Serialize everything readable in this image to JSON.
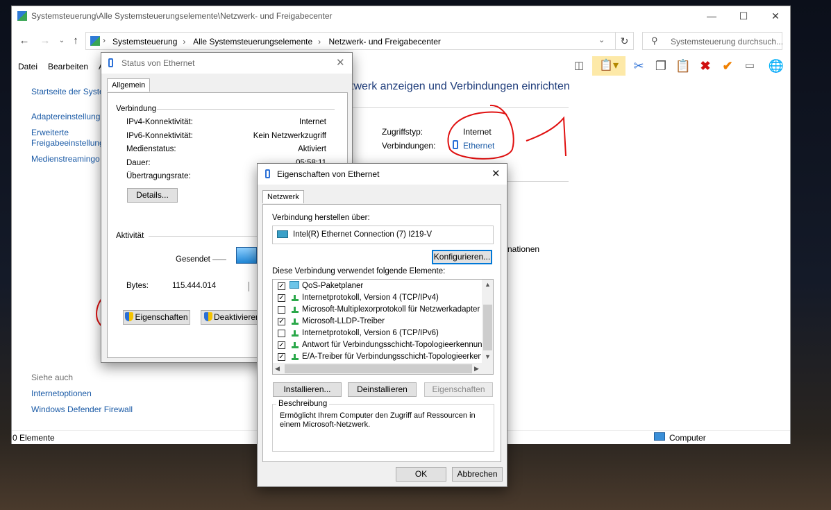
{
  "window": {
    "title": "Systemsteuerung\\Alle Systemsteuerungselemente\\Netzwerk- und Freigabecenter",
    "breadcrumbs": [
      "Systemsteuerung",
      "Alle Systemsteuerungselemente",
      "Netzwerk- und Freigabecenter"
    ],
    "search_placeholder": "Systemsteuerung durchsuch...",
    "menu": [
      "Datei",
      "Bearbeiten",
      "A"
    ],
    "heading": "twerk anzeigen und Verbindungen einrichten",
    "status_count": "0 Elemente",
    "status_location": "Computer"
  },
  "sidebar": {
    "items": [
      "Startseite der Syster",
      "Adaptereinstellung",
      "Erweiterte",
      "Freigabeeinstellung",
      "Medienstreamingo"
    ],
    "see_also_title": "Siehe auch",
    "see_also": [
      "Internetoptionen",
      "Windows Defender Firewall"
    ]
  },
  "network": {
    "access_label": "Zugriffstyp:",
    "access_value": "Internet",
    "connections_label": "Verbindungen:",
    "connections_value": "Ethernet",
    "partial_text": "nationen"
  },
  "status_dialog": {
    "title": "Status von Ethernet",
    "tab": "Allgemein",
    "group_connection": "Verbindung",
    "rows": [
      {
        "label": "IPv4-Konnektivität:",
        "value": "Internet"
      },
      {
        "label": "IPv6-Konnektivität:",
        "value": "Kein Netzwerkzugriff"
      },
      {
        "label": "Medienstatus:",
        "value": "Aktiviert"
      },
      {
        "label": "Dauer:",
        "value": "05:58:11"
      },
      {
        "label": "Übertragungsrate:",
        "value": ""
      }
    ],
    "details_button": "Details...",
    "group_activity": "Aktivität",
    "sent_label": "Gesendet",
    "bytes_label": "Bytes:",
    "bytes_value": "115.444.014",
    "properties_button": "Eigenschaften",
    "deactivate_button": "Deaktivieren"
  },
  "props_dialog": {
    "title": "Eigenschaften von Ethernet",
    "tab": "Netzwerk",
    "connect_via_label": "Verbindung herstellen über:",
    "adapter": "Intel(R) Ethernet Connection (7) I219-V",
    "configure_button": "Konfigurieren...",
    "items_label": "Diese Verbindung verwendet folgende Elemente:",
    "items": [
      {
        "label": "QoS-Paketplaner",
        "checked": true
      },
      {
        "label": "Internetprotokoll, Version 4 (TCP/IPv4)",
        "checked": true
      },
      {
        "label": "Microsoft-Multiplexorprotokoll für Netzwerkadapter",
        "checked": false
      },
      {
        "label": "Microsoft-LLDP-Treiber",
        "checked": true
      },
      {
        "label": "Internetprotokoll, Version 6 (TCP/IPv6)",
        "checked": false
      },
      {
        "label": "Antwort für Verbindungsschicht-Topologieerkennung",
        "checked": true
      },
      {
        "label": "E/A-Treiber für Verbindungsschicht-Topologieerkennung",
        "checked": true
      }
    ],
    "install_button": "Installieren...",
    "uninstall_button": "Deinstallieren",
    "properties_button": "Eigenschaften",
    "description_title": "Beschreibung",
    "description_text": "Ermöglicht Ihrem Computer den Zugriff auf Ressourcen in einem Microsoft-Netzwerk.",
    "ok_button": "OK",
    "cancel_button": "Abbrechen"
  },
  "colors": {
    "link": "#1a5aa6",
    "annotation": "#e01010",
    "focus": "#0078d7"
  }
}
